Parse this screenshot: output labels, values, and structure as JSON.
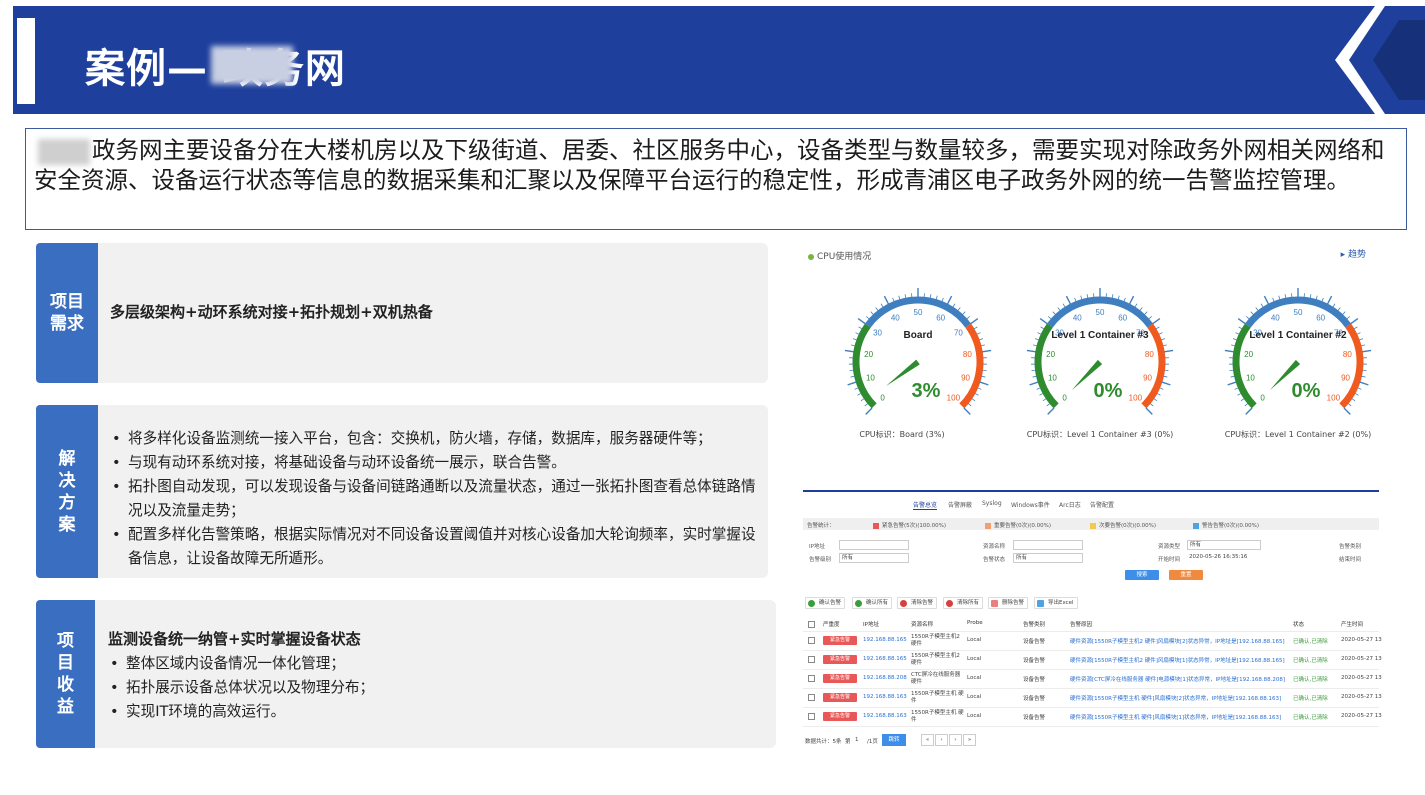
{
  "header": {
    "title": "案例—      政务网"
  },
  "intro": {
    "text": "政务网主要设备分在大楼机房以及下级街道、居委、社区服务中心，设备类型与数量较多，需要实现对除政务外网相关网络和安全资源、设备运行状态等信息的数据采集和汇聚以及保障平台运行的稳定性，形成青浦区电子政务外网的统一告警监控管理。"
  },
  "cards": {
    "need": {
      "tag": "项目\n需求",
      "headline": "多层级架构+动环系统对接+拓扑规划+双机热备"
    },
    "solution": {
      "tag": "解\n决\n方\n案",
      "items": [
        "将多样化设备监测统一接入平台，包含：交换机，防火墙，存储，数据库，服务器硬件等；",
        "与现有动环系统对接，将基础设备与动环设备统一展示，联合告警。",
        "拓扑图自动发现，可以发现设备与设备间链路通断以及流量状态，通过一张拓扑图查看总体链路情况以及流量走势；",
        "配置多样化告警策略，根据实际情况对不同设备设置阈值并对核心设备加大轮询频率，实时掌握设备信息，让设备故障无所遁形。"
      ]
    },
    "benefit": {
      "tag": "项\n目\n收\n益",
      "headline": "监测设备统一纳管+实时掌握设备状态",
      "items": [
        "整体区域内设备情况一体化管理；",
        "拓扑展示设备总体状况以及物理分布；",
        "实现IT环境的高效运行。"
      ]
    }
  },
  "cpu": {
    "title": "CPU使用情况",
    "trend_label": "趋势",
    "gauges": [
      {
        "name": "Board",
        "value": 3,
        "display": "3%",
        "caption": "CPU标识：Board (3%)"
      },
      {
        "name": "Level 1 Container #3",
        "value": 0,
        "display": "0%",
        "caption": "CPU标识：Level 1 Container #3 (0%)"
      },
      {
        "name": "Level 1 Container #2",
        "value": 0,
        "display": "0%",
        "caption": "CPU标识：Level 1 Container #2 (0%)"
      }
    ],
    "ticks": [
      "0",
      "10",
      "20",
      "30",
      "40",
      "50",
      "60",
      "70",
      "80",
      "90",
      "100"
    ]
  },
  "alarm": {
    "tabs": [
      "告警总览",
      "告警屏蔽",
      "Syslog",
      "Windows事件",
      "Arc日志",
      "告警配置"
    ],
    "stats_label": "告警统计：",
    "stats": [
      {
        "label": "紧急告警(5次)(100.00%)",
        "color": "#e85858"
      },
      {
        "label": "重要告警(0次)(0.00%)",
        "color": "#f0a070"
      },
      {
        "label": "次要告警(0次)(0.00%)",
        "color": "#f2c94c"
      },
      {
        "label": "警告告警(0次)(0.00%)",
        "color": "#4fa3e0"
      }
    ],
    "form": {
      "ip_label": "IP地址",
      "level_label": "告警级别",
      "level_value": "所有",
      "res_name_label": "资源名称",
      "status_label": "告警状态",
      "status_value": "所有",
      "res_type_label": "资源类型",
      "res_type_value": "所有",
      "start_label": "开始时间",
      "start_value": "2020-05-26 16:35:16",
      "cat_label": "告警类别",
      "end_label": "结束时间",
      "search_label": "搜索",
      "reset_label": "重置"
    },
    "actions": [
      "确认告警",
      "确认所有",
      "清除告警",
      "清除所有",
      "删除告警",
      "导出Excel"
    ],
    "columns": [
      "严重度",
      "IP地址",
      "资源名称",
      "Probe",
      "告警类别",
      "告警原因",
      "状态",
      "产生时间"
    ],
    "rows": [
      {
        "sev": "紧急告警",
        "ip": "192.168.88.165",
        "res": "1550R子模型主机2 硬件",
        "probe": "Local",
        "cat": "设备告警",
        "reason": "硬件资源[1550R子模型主机2 硬件]风扇模块[2]状态异常，IP地址是[192.168.88.165]",
        "status": "已确认,已清除",
        "time": "2020-05-27 13"
      },
      {
        "sev": "紧急告警",
        "ip": "192.168.88.165",
        "res": "1550R子模型主机2 硬件",
        "probe": "Local",
        "cat": "设备告警",
        "reason": "硬件资源[1550R子模型主机2 硬件]风扇模块[1]状态异常，IP地址是[192.168.88.165]",
        "status": "已确认,已清除",
        "time": "2020-05-27 13"
      },
      {
        "sev": "紧急告警",
        "ip": "192.168.88.208",
        "res": "CTC屏冷在线服务器 硬件",
        "probe": "Local",
        "cat": "设备告警",
        "reason": "硬件资源[CTC屏冷在线服务器 硬件]电源模块[1]状态异常，IP地址是[192.168.88.208]",
        "status": "已确认,已清除",
        "time": "2020-05-27 13"
      },
      {
        "sev": "紧急告警",
        "ip": "192.168.88.163",
        "res": "1550R子模型主机 硬件",
        "probe": "Local",
        "cat": "设备告警",
        "reason": "硬件资源[1550R子模型主机 硬件]风扇模块[2]状态异常，IP地址是[192.168.88.163]",
        "status": "已确认,已清除",
        "time": "2020-05-27 13"
      },
      {
        "sev": "紧急告警",
        "ip": "192.168.88.163",
        "res": "1550R子模型主机 硬件",
        "probe": "Local",
        "cat": "设备告警",
        "reason": "硬件资源[1550R子模型主机 硬件]风扇模块[1]状态异常，IP地址是[192.168.88.163]",
        "status": "已确认,已清除",
        "time": "2020-05-27 13"
      }
    ],
    "pager": {
      "total": "数据共计：5条",
      "page_prefix": "第",
      "page": "1",
      "page_suffix": "/1页",
      "jump": "跳转",
      "nav": [
        "«",
        "‹",
        "›",
        "»"
      ]
    }
  }
}
